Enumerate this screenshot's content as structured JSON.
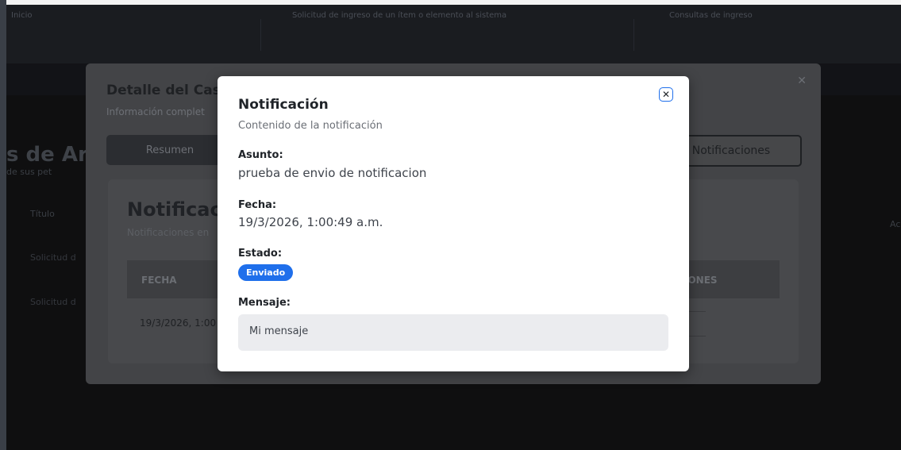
{
  "background": {
    "header_texts": [
      "Inicio",
      "Solicitud de ingreso de un ítem o elemento al sistema",
      "Consultas de ingreso"
    ],
    "page_title": "s de Arbi",
    "page_subtitle": "de sus pet",
    "table_col_left": "Título",
    "table_col_right": "Ac",
    "rows": [
      "Solicitud d",
      "Solicitud d"
    ]
  },
  "outer_modal": {
    "title": "Detalle del Caso",
    "subtitle": "Información complet",
    "tab_summary": "Resumen",
    "tab_notifications": "Notificaciones",
    "close_icon": "close-icon",
    "card": {
      "title": "Notificacio",
      "subtitle": "Notificaciones en",
      "headers": [
        "FECHA",
        "IONES"
      ],
      "row_date": "19/3/2026, 1:00"
    }
  },
  "notification_modal": {
    "title": "Notificación",
    "subtitle": "Contenido de la notificación",
    "close_icon": "close-icon",
    "close_symbol": "✕",
    "fields": {
      "subject_label": "Asunto:",
      "subject_value": "prueba de envio de notificacion",
      "date_label": "Fecha:",
      "date_value": "19/3/2026, 1:00:49 a.m.",
      "status_label": "Estado:",
      "status_value": "Enviado",
      "message_label": "Mensaje:",
      "message_value": "Mi mensaje"
    }
  },
  "colors": {
    "accent": "#1f6feb",
    "overlay": "#0f0f10",
    "modal_bg": "#ffffff",
    "message_box_bg": "#ebecef"
  }
}
